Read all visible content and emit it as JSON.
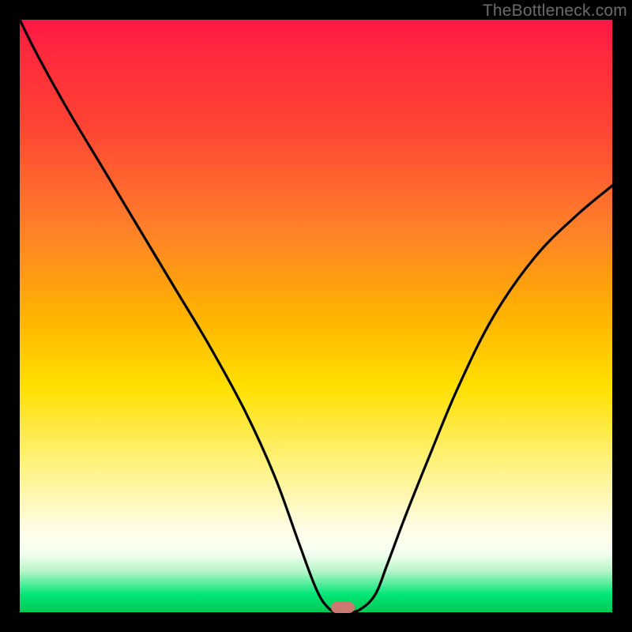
{
  "watermark": "TheBottleneck.com",
  "colors": {
    "frame": "#000000",
    "gradient_stops": [
      "#ff1744",
      "#ff7f2a",
      "#ffe000",
      "#fffde7",
      "#00c853"
    ],
    "curve": "#000000",
    "marker": "#cc7a71"
  },
  "chart_data": {
    "type": "line",
    "title": "",
    "xlabel": "",
    "ylabel": "",
    "xlim": [
      0,
      100
    ],
    "ylim": [
      0,
      100
    ],
    "x": [
      0,
      3,
      8,
      14,
      20,
      26,
      32,
      38,
      43,
      47,
      50,
      52,
      53.7,
      55.5,
      57.5,
      60,
      62,
      65,
      69,
      74,
      80,
      87,
      94,
      100
    ],
    "values": [
      100,
      94,
      85,
      75,
      65,
      55,
      45,
      34,
      23,
      12,
      4,
      0.8,
      0,
      0,
      0.5,
      3,
      8,
      16,
      26,
      38,
      50,
      60,
      67,
      72
    ],
    "note": "y is plotted downward from top (y=100 at top of plot, y=0 at bottom). Values approximate the V-shaped bottleneck curve with minimum near x≈54.",
    "marker": {
      "x": 54.5,
      "y": 0.8,
      "shape": "rounded-rect"
    }
  }
}
